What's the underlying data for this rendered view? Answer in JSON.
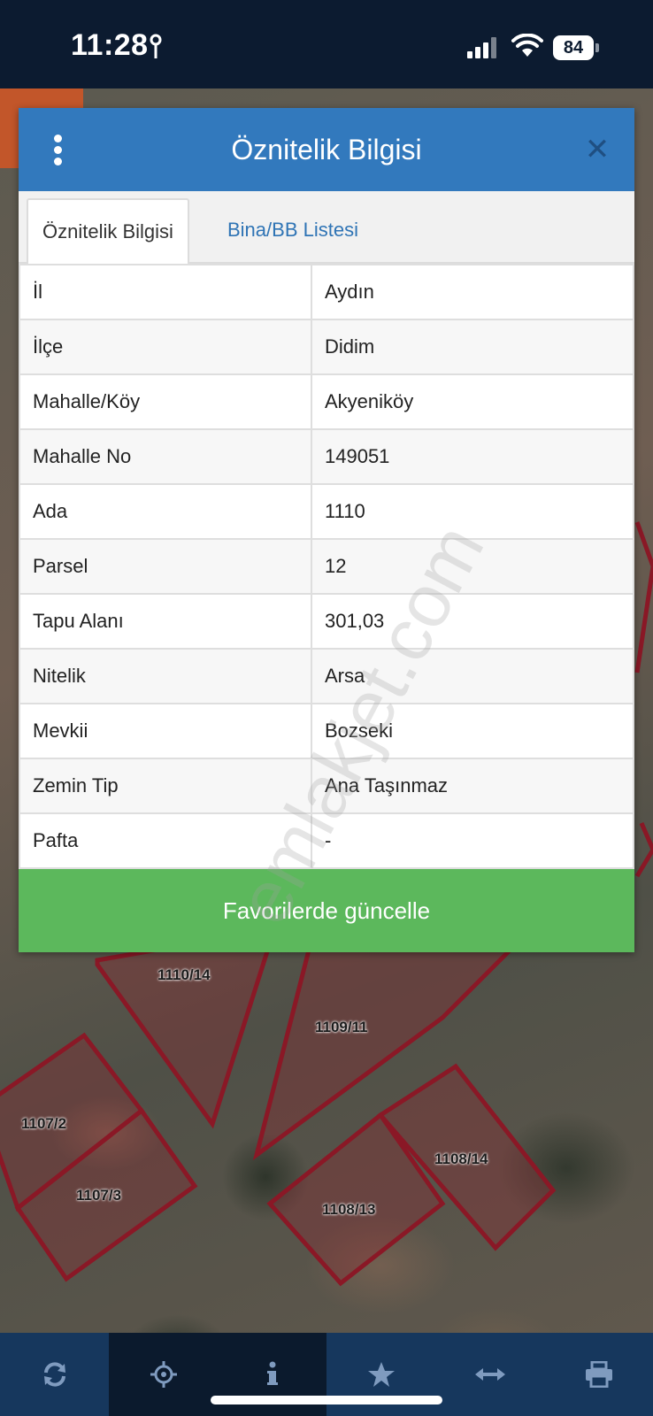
{
  "status_bar": {
    "time": "11:28",
    "battery": "84"
  },
  "dialog": {
    "title": "Öznitelik Bilgisi",
    "tabs": [
      {
        "label": "Öznitelik Bilgisi",
        "active": true
      },
      {
        "label": "Bina/BB Listesi",
        "active": false
      }
    ],
    "rows": [
      {
        "key": "İl",
        "value": "Aydın"
      },
      {
        "key": "İlçe",
        "value": "Didim"
      },
      {
        "key": "Mahalle/Köy",
        "value": "Akyeniköy"
      },
      {
        "key": "Mahalle No",
        "value": "149051"
      },
      {
        "key": "Ada",
        "value": "1110"
      },
      {
        "key": "Parsel",
        "value": "12"
      },
      {
        "key": "Tapu Alanı",
        "value": "301,03"
      },
      {
        "key": "Nitelik",
        "value": "Arsa"
      },
      {
        "key": "Mevkii",
        "value": "Bozseki"
      },
      {
        "key": "Zemin Tip",
        "value": "Ana Taşınmaz"
      },
      {
        "key": "Pafta",
        "value": "-"
      }
    ],
    "favorite_button_label": "Favorilerde güncelle"
  },
  "map": {
    "parcel_labels": [
      "1110/14",
      "1109/11",
      "1107/2",
      "1107/3",
      "1108/14",
      "1108/13"
    ]
  },
  "watermark": "emlakjet.com",
  "toolbar": {
    "icons": [
      "refresh-icon",
      "locate-icon",
      "info-icon",
      "star-icon",
      "measure-icon",
      "print-icon"
    ]
  },
  "colors": {
    "header_blue": "#3279bd",
    "button_green": "#5cb85c",
    "toolbar": "#16375d",
    "parcel_stroke": "#8a1826"
  }
}
